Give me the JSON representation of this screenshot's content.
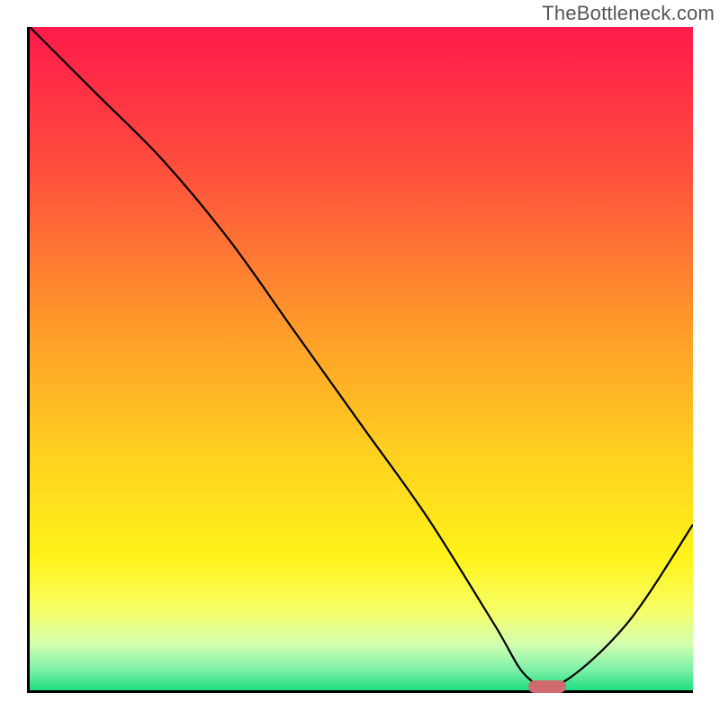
{
  "watermark": "TheBottleneck.com",
  "chart_data": {
    "type": "line",
    "title": "",
    "xlabel": "",
    "ylabel": "",
    "xlim": [
      0,
      100
    ],
    "ylim": [
      0,
      100
    ],
    "x": [
      0,
      10,
      20,
      30,
      40,
      50,
      60,
      70,
      75,
      80,
      90,
      100
    ],
    "values": [
      100,
      90,
      80,
      68,
      54,
      40,
      26,
      10,
      2,
      1,
      10,
      25
    ],
    "optimal_point": {
      "x": 78,
      "y": 0
    },
    "gradient_stops": [
      {
        "offset": 0,
        "color": "#ff1a4b"
      },
      {
        "offset": 0.2,
        "color": "#ff4a3e"
      },
      {
        "offset": 0.45,
        "color": "#ff9a2a"
      },
      {
        "offset": 0.65,
        "color": "#ffd21f"
      },
      {
        "offset": 0.8,
        "color": "#fff31a"
      },
      {
        "offset": 0.88,
        "color": "#f6ff66"
      },
      {
        "offset": 0.93,
        "color": "#d4ffb0"
      },
      {
        "offset": 0.97,
        "color": "#7af0a8"
      },
      {
        "offset": 1.0,
        "color": "#1fdd80"
      }
    ],
    "marker_color": "#cf6a6f"
  }
}
